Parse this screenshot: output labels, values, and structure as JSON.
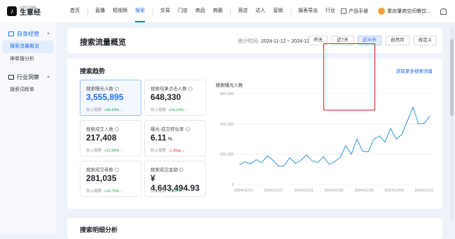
{
  "app": {
    "logo_sub": "抖音生活服务",
    "logo_main": "生意经"
  },
  "nav": {
    "items": [
      {
        "label": "首页"
      },
      {
        "label": "直播"
      },
      {
        "label": "短视频"
      },
      {
        "label": "搜索",
        "active": true
      },
      {
        "label": "交易"
      },
      {
        "label": "门店"
      },
      {
        "label": "商品"
      },
      {
        "label": "商圈"
      },
      {
        "label": "竞店"
      },
      {
        "label": "达人"
      },
      {
        "label": "营销"
      },
      {
        "label": "报表导出"
      },
      {
        "label": "行业"
      }
    ],
    "new_badge": "NEW"
  },
  "topbar": {
    "manual": "产品手册",
    "user": "重庆肇商空间餐饮..."
  },
  "sidebar": {
    "group1": "自身经营",
    "group1_items": [
      "搜索流量概览",
      "神单搜分析"
    ],
    "group2": "行业洞察",
    "group2_items": [
      "搜索词榜单"
    ]
  },
  "header": {
    "title": "搜索流量概览",
    "stat_label": "统计时间:",
    "stat_range": "2024-11-12 ~ 2024-12-11",
    "time_buttons": [
      "昨天",
      "近7天",
      "近30天",
      "自然月",
      "自定义"
    ],
    "active_time": 2
  },
  "trend": {
    "title": "搜索趋势",
    "link": "获取更多搜索流量",
    "chart_title": "搜索曝光人数",
    "cards": [
      {
        "label": "搜索曝光人数",
        "value": "3,555,895",
        "cmp_label": "较上周期",
        "cmp_value": "+36.59%",
        "dir": "up",
        "selected": true
      },
      {
        "label": "搜索结果点击人数",
        "value": "648,330",
        "cmp_label": "较上周期",
        "cmp_value": "+24.10%",
        "dir": "up"
      },
      {
        "label": "搜索成交人数",
        "value": "217,408",
        "cmp_label": "较上周期",
        "cmp_value": "+12.58%",
        "dir": "up"
      },
      {
        "label": "曝光-成交转化率",
        "value": "6.11",
        "unit": "%",
        "cmp_label": "较上周期",
        "cmp_value": "-1.30pp",
        "dir": "down"
      },
      {
        "label": "搜索成交券数",
        "value": "281,035",
        "cmp_label": "较上周期",
        "cmp_value": "+10.75%",
        "dir": "up"
      },
      {
        "label": "搜索成交金额",
        "value": "¥ 4,643,494.93",
        "cmp_label": "较上周期",
        "cmp_value": "+7.04%",
        "dir": "up"
      }
    ]
  },
  "chart_data": {
    "type": "line",
    "title": "搜索曝光人数",
    "xlabel": "",
    "ylabel": "",
    "x": [
      "2024/11/12",
      "2024/11/13",
      "2024/11/14",
      "2024/11/15",
      "2024/11/16",
      "2024/11/17",
      "2024/11/18",
      "2024/11/19",
      "2024/11/20",
      "2024/11/21",
      "2024/11/22",
      "2024/11/23",
      "2024/11/24",
      "2024/11/25",
      "2024/11/26",
      "2024/11/27",
      "2024/11/28",
      "2024/11/29",
      "2024/11/30",
      "2024/12/01",
      "2024/12/02",
      "2024/12/03",
      "2024/12/04",
      "2024/12/05",
      "2024/12/06",
      "2024/12/07",
      "2024/12/08",
      "2024/12/09",
      "2024/12/10",
      "2024/12/11"
    ],
    "x_tick_labels": [
      "2024/11/12",
      "2024/11/17",
      "2024/11/21",
      "2024/11/25",
      "2024/11/29",
      "2024/12/03",
      "2024/12/11"
    ],
    "series": [
      {
        "values": [
          65000,
          75000,
          68000,
          82000,
          72000,
          95000,
          80000,
          60000,
          62000,
          88000,
          70000,
          80000,
          98000,
          78000,
          72000,
          92000,
          67000,
          75000,
          90000,
          128000,
          100000,
          150000,
          110000,
          108000,
          150000,
          160000,
          140000,
          185000,
          150000,
          165000,
          210000,
          255000,
          200000,
          202000,
          225000
        ]
      }
    ],
    "ylim": [
      0,
      300000
    ],
    "y_ticks": [
      "300,000",
      "200,000",
      "100,000",
      "0"
    ],
    "grid": true,
    "color": "#3b9ed8"
  },
  "bottom": {
    "title": "搜索明细分析"
  }
}
